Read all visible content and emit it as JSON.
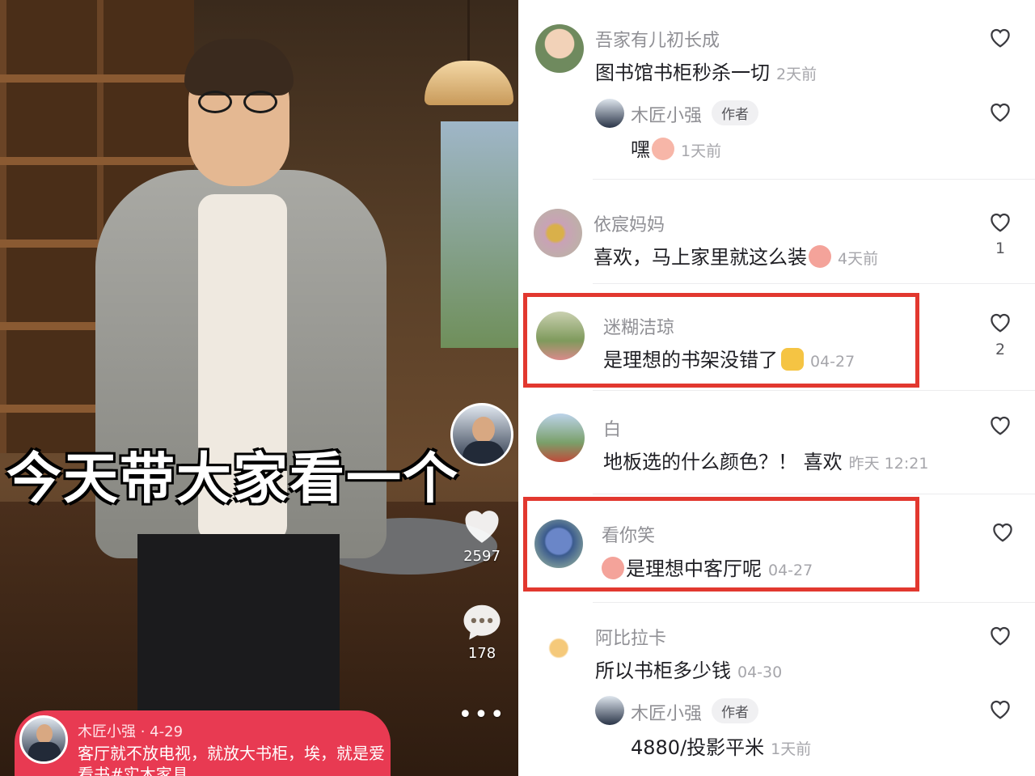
{
  "video": {
    "subtitle": "今天带大家看一个",
    "like_count": "2597",
    "comment_count": "178",
    "more_label": "•••",
    "caption": {
      "author": "木匠小强",
      "date": "· 4-29",
      "text": "客厅就不放电视，就放大书柜，埃，就是爱看书#实木家具"
    }
  },
  "comments": {
    "author_tag": "作者",
    "items": [
      {
        "user": "吾家有儿初长成",
        "text": "图书馆书柜秒杀一切",
        "time": "2天前",
        "likes": ""
      },
      {
        "user": "木匠小强",
        "text": "嘿",
        "time": "1天前",
        "likes": "",
        "is_author": true
      },
      {
        "user": "依宸妈妈",
        "text": "喜欢，马上家里就这么装",
        "time": "4天前",
        "likes": "1"
      },
      {
        "user": "迷糊洁琼",
        "text": "是理想的书架没错了",
        "time": "04-27",
        "likes": "2"
      },
      {
        "user": "白",
        "text": "地板选的什么颜色？！ 喜欢",
        "time": "昨天 12:21",
        "likes": ""
      },
      {
        "user": "看你笑",
        "text": "是理想中客厅呢",
        "time": "04-27",
        "likes": ""
      },
      {
        "user": "阿比拉卡",
        "text": "所以书柜多少钱",
        "time": "04-30",
        "likes": ""
      },
      {
        "user": "木匠小强",
        "text": "4880/投影平米",
        "time": "1天前",
        "likes": "",
        "is_author": true
      }
    ]
  },
  "colors": {
    "highlight": "#e2382f",
    "caption_bg": "#e83a52",
    "muted_text": "#8f8f94"
  }
}
